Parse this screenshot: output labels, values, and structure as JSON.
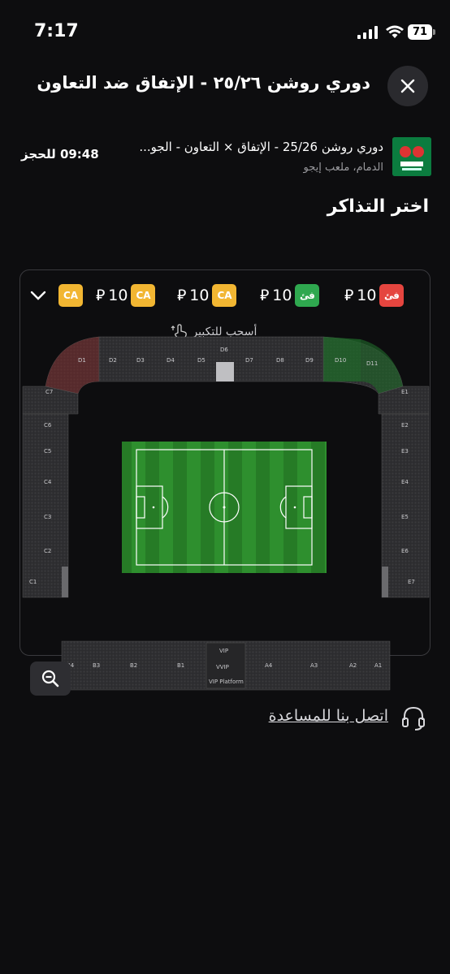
{
  "status_bar": {
    "time": "7:17",
    "battery": "71"
  },
  "header": {
    "title": "دوري روشن ٢٥/٢٦ - الإتفاق ضد التعاون"
  },
  "event": {
    "name": "دوري روشن 25/26 - الإتفاق × التعاون - الجو...",
    "venue": "الدمام، ملعب إيجو",
    "timer": "09:48 للحجز"
  },
  "section_title": "اختر التذاكر",
  "price_chips": [
    {
      "badge": "فئ",
      "price": "10",
      "color": "#e5453f"
    },
    {
      "badge": "فئ",
      "price": "10",
      "color": "#2fa84f"
    },
    {
      "badge": "CA",
      "price": "10",
      "color": "#f2b632"
    },
    {
      "badge": "CA",
      "price": "10",
      "color": "#f2b632"
    },
    {
      "badge": "CA",
      "price": "",
      "color": "#f2b632"
    }
  ],
  "currency_symbol": "⃁",
  "drag_hint": "أسحب للتكبير",
  "sections": {
    "top": [
      "D1",
      "D2",
      "D3",
      "D4",
      "D5",
      "D6",
      "D7",
      "D8",
      "D9",
      "D10",
      "D11"
    ],
    "left": [
      "C7",
      "C6",
      "C5",
      "C4",
      "C3",
      "C2",
      "C1"
    ],
    "right": [
      "E1",
      "E2",
      "E3",
      "E4",
      "E5",
      "E6",
      "E7"
    ],
    "bottom": [
      "B4",
      "B3",
      "B2",
      "B1",
      "VIP",
      "VVIP",
      "VIP Platform",
      "A4",
      "A3",
      "A2",
      "A1"
    ]
  },
  "help": {
    "label": "اتصل بنا للمساعدة"
  },
  "colors": {
    "background": "#0d0d0f",
    "red_section": "#7a2a2a",
    "green_section": "#1f6a2a",
    "pitch": "#2a8a2a"
  }
}
